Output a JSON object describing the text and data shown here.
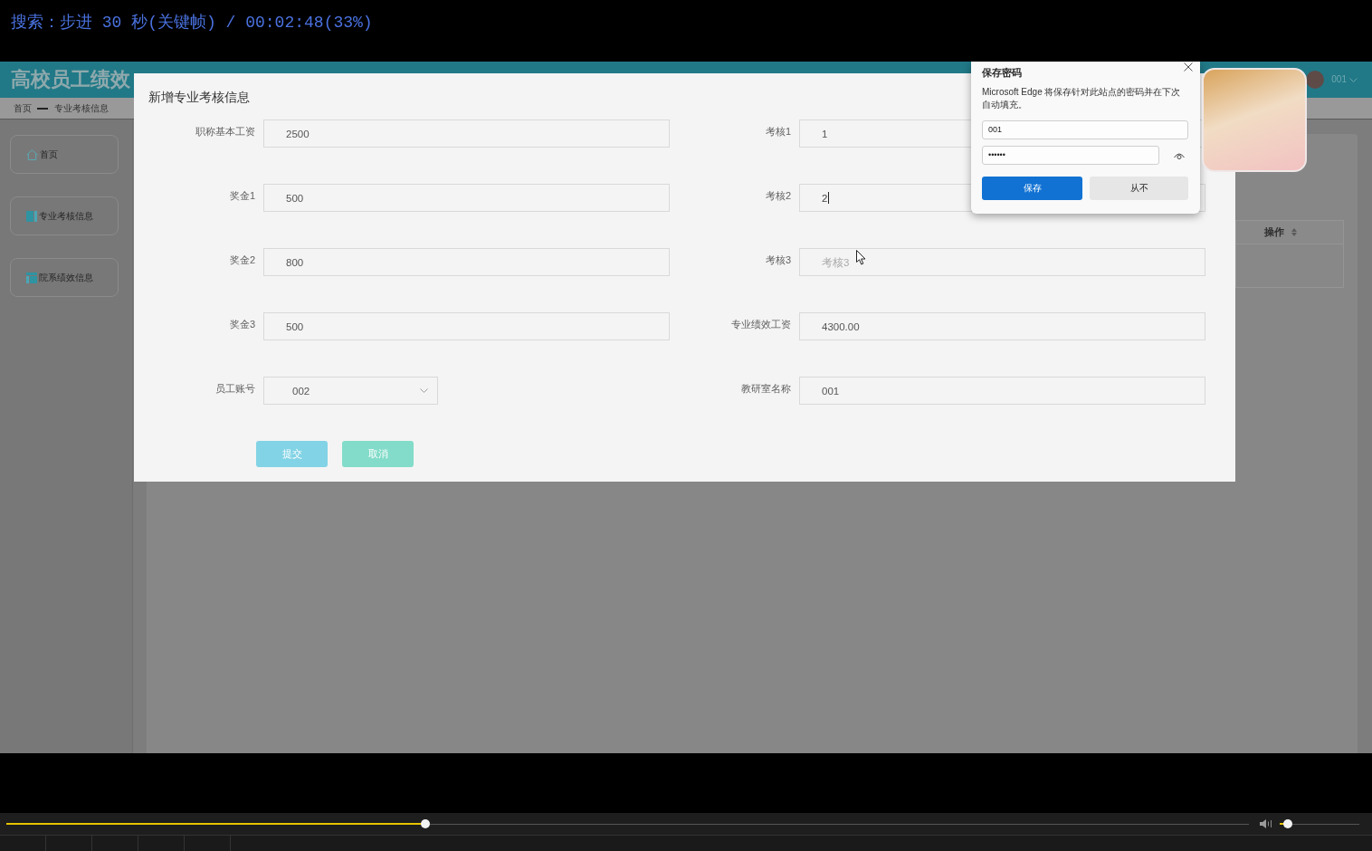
{
  "player": {
    "osd": "搜索：步进 30 秒(关键帧) / 00:02:48(33%)",
    "progress": {
      "level": 0.337
    },
    "volume": {
      "level": 0.1
    }
  },
  "app": {
    "title": "高校员工绩效",
    "user": "001",
    "breadcrumb": [
      "首页",
      "专业考核信息"
    ],
    "sidebar": {
      "items": [
        {
          "label": "首页"
        },
        {
          "label": "专业考核信息"
        },
        {
          "label": "院系绩效信息"
        }
      ]
    },
    "table": {
      "columns": [
        "操作"
      ]
    }
  },
  "dialog": {
    "title": "新增专业考核信息",
    "fields": [
      {
        "label": "职称基本工资",
        "kind": "text",
        "value": "2500",
        "focused": false
      },
      {
        "label": "考核1",
        "kind": "text",
        "value": "1",
        "focused": false
      },
      {
        "label": "奖金1",
        "kind": "text",
        "value": "500",
        "focused": false
      },
      {
        "label": "考核2",
        "kind": "text",
        "value": "2",
        "focused": true
      },
      {
        "label": "奖金2",
        "kind": "text",
        "value": "800",
        "focused": false
      },
      {
        "label": "考核3",
        "kind": "text",
        "placeholder": "考核3",
        "focused": false
      },
      {
        "label": "奖金3",
        "kind": "text",
        "value": "500",
        "focused": false
      },
      {
        "label": "专业绩效工资",
        "kind": "text",
        "value": "4300.00",
        "focused": false
      },
      {
        "label": "员工账号",
        "kind": "select",
        "value": "002",
        "focused": false
      },
      {
        "label": "教研室名称",
        "kind": "text",
        "value": "001",
        "focused": false
      }
    ],
    "buttons": [
      {
        "label": "提交",
        "kind": "submit"
      },
      {
        "label": "取消",
        "kind": "cancel"
      }
    ]
  },
  "password_prompt": {
    "title": "保存密码",
    "message": "Microsoft Edge 将保存针对此站点的密码并在下次自动填充。",
    "username": "001",
    "password": "••••••",
    "buttons": [
      {
        "label": "保存",
        "kind": "primary"
      },
      {
        "label": "从不",
        "kind": "secondary"
      }
    ]
  }
}
